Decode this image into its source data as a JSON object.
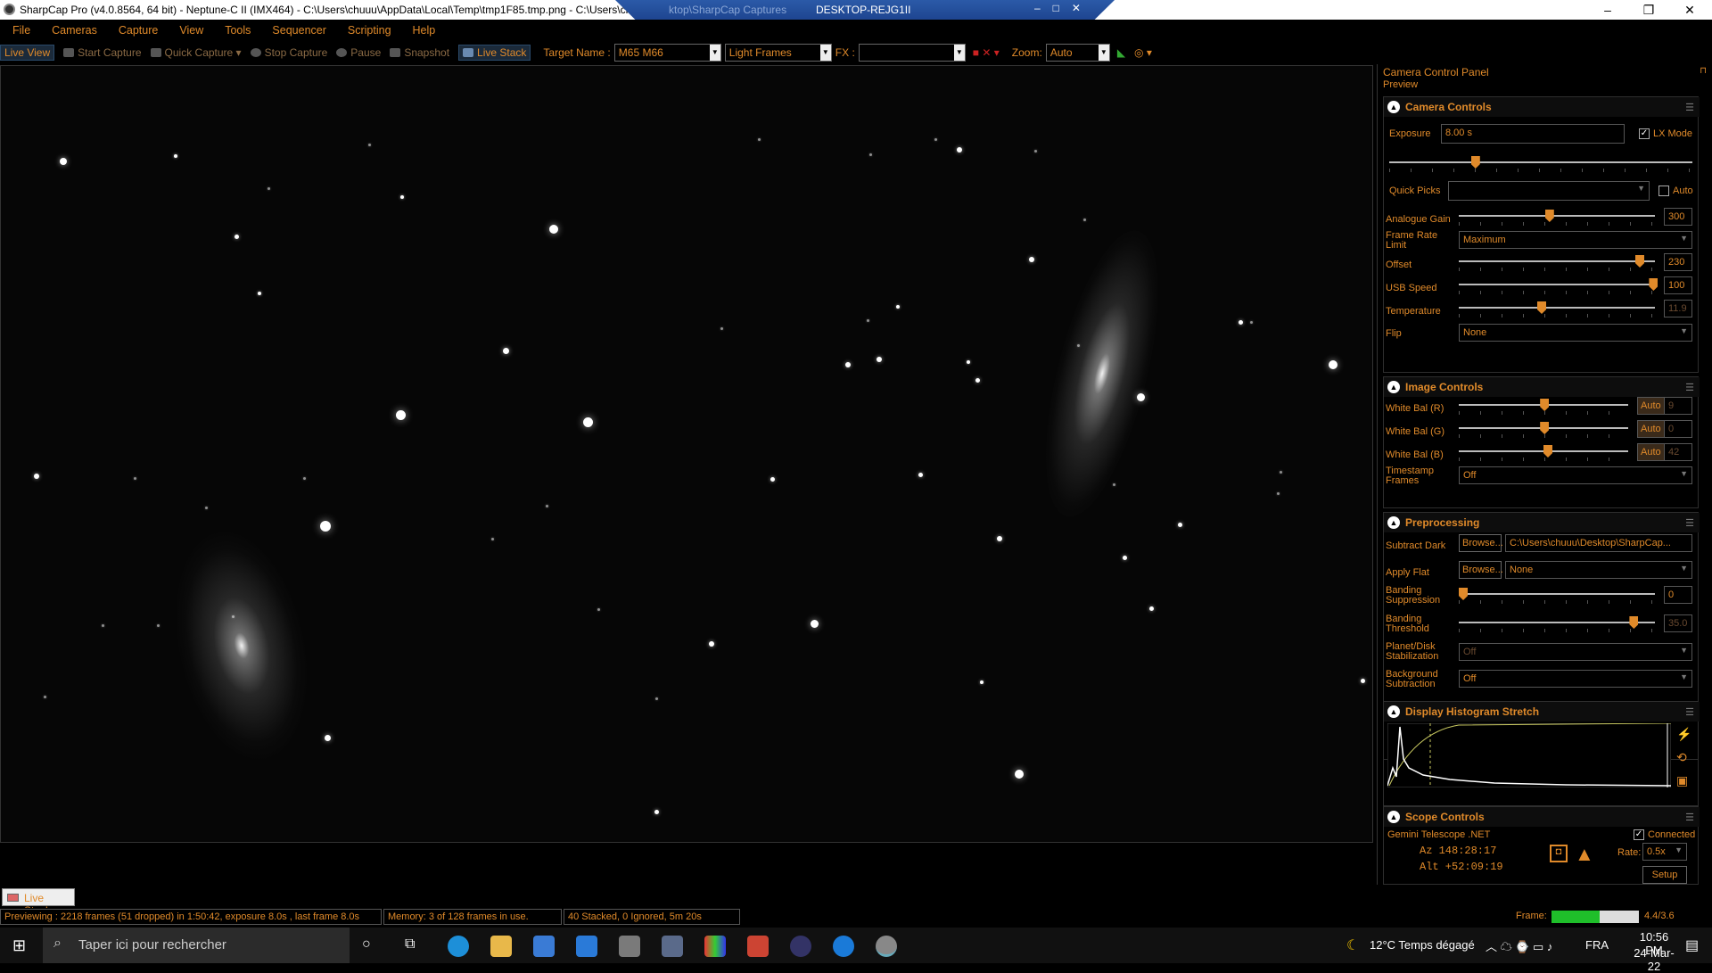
{
  "window": {
    "title": "SharpCap Pro (v4.0.8564, 64 bit) - Neptune-C II (IMX464) - C:\\Users\\chuuu\\AppData\\Local\\Temp\\tmp1F85.tmp.png - C:\\Users\\ch",
    "remote_title": "DESKTOP-REJG1II",
    "remote_ghost": "ktop\\SharpCap Captures"
  },
  "menu": [
    "File",
    "Cameras",
    "Capture",
    "View",
    "Tools",
    "Sequencer",
    "Scripting",
    "Help"
  ],
  "toolbar": {
    "live_view": "Live View",
    "start_capture": "Start Capture",
    "quick_capture": "Quick Capture",
    "stop_capture": "Stop Capture",
    "pause": "Pause",
    "snapshot": "Snapshot",
    "live_stack": "Live Stack",
    "target_label": "Target Name :",
    "target_value": "M65 M66",
    "frame_type": "Light Frames",
    "fx_label": "FX :",
    "fx_value": "",
    "zoom_label": "Zoom:",
    "zoom_value": "Auto"
  },
  "panel": {
    "title": "Camera Control Panel",
    "preview_label": "Preview",
    "camera_controls": {
      "header": "Camera Controls",
      "exposure_label": "Exposure",
      "exposure_value": "8.00 s",
      "lx_mode": "LX Mode",
      "quick_picks": "Quick Picks",
      "auto": "Auto",
      "analogue_gain_label": "Analogue Gain",
      "analogue_gain_value": "300",
      "frame_rate_label_1": "Frame Rate",
      "frame_rate_label_2": "Limit",
      "frame_rate_value": "Maximum",
      "offset_label": "Offset",
      "offset_value": "230",
      "usb_speed_label": "USB Speed",
      "usb_speed_value": "100",
      "temperature_label": "Temperature",
      "temperature_value": "11.9",
      "flip_label": "Flip",
      "flip_value": "None"
    },
    "image_controls": {
      "header": "Image Controls",
      "wb_r_label": "White Bal (R)",
      "wb_r_value": "9",
      "wb_g_label": "White Bal (G)",
      "wb_g_value": "0",
      "wb_b_label": "White Bal (B)",
      "wb_b_value": "42",
      "auto": "Auto",
      "timestamp_label_1": "Timestamp",
      "timestamp_label_2": "Frames",
      "timestamp_value": "Off"
    },
    "preprocessing": {
      "header": "Preprocessing",
      "subtract_dark_label": "Subtract Dark",
      "browse": "Browse...",
      "subtract_dark_value": "C:\\Users\\chuuu\\Desktop\\SharpCap...",
      "apply_flat_label": "Apply Flat",
      "apply_flat_value": "None",
      "banding_supp_1": "Banding",
      "banding_supp_2": "Suppression",
      "banding_supp_value": "0",
      "banding_thr_1": "Banding",
      "banding_thr_2": "Threshold",
      "banding_thr_value": "35.0",
      "planet_1": "Planet/Disk",
      "planet_2": "Stabilization",
      "planet_value": "Off",
      "bg_1": "Background",
      "bg_2": "Subtraction",
      "bg_value": "Off"
    },
    "histogram": {
      "header": "Display Histogram Stretch"
    },
    "scope": {
      "header": "Scope Controls",
      "telescope": "Gemini Telescope .NET",
      "connected": "Connected",
      "az": "Az   148:28:17",
      "alt": "Alt  +52:09:19",
      "rate_label": "Rate:",
      "rate_value": "0.5x",
      "setup": "Setup"
    }
  },
  "status": {
    "tab": "Live Stack",
    "previewing": "Previewing : 2218 frames (51 dropped) in 1:50:42, exposure 8.0s , last frame 8.0s",
    "memory": "Memory: 3 of 128 frames in use.",
    "stacked": "40 Stacked, 0 Ignored, 5m 20s",
    "frame_label": "Frame:",
    "frame_value": "4.4/3.6",
    "frame_fill": 0.55
  },
  "taskbar": {
    "search_placeholder": "Taper ici pour rechercher",
    "weather": "12°C  Temps dégagé",
    "lang": "FRA",
    "time": "10:56 PM",
    "date": "24-Mar-22"
  }
}
